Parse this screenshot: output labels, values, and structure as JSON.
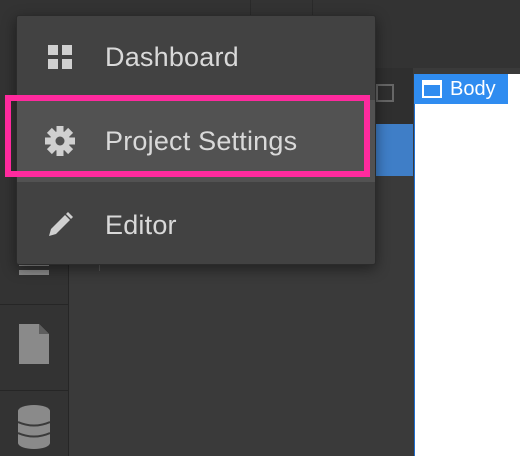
{
  "menu": {
    "items": [
      {
        "label": "Dashboard",
        "icon": "grid-icon"
      },
      {
        "label": "Project Settings",
        "icon": "gear-icon",
        "active": true
      },
      {
        "label": "Editor",
        "icon": "pencil-icon"
      }
    ]
  },
  "canvas": {
    "body_label": "Body"
  },
  "colors": {
    "highlight": "#ff2a9e",
    "accent": "#2f8cf0",
    "menu_bg": "#424242"
  }
}
